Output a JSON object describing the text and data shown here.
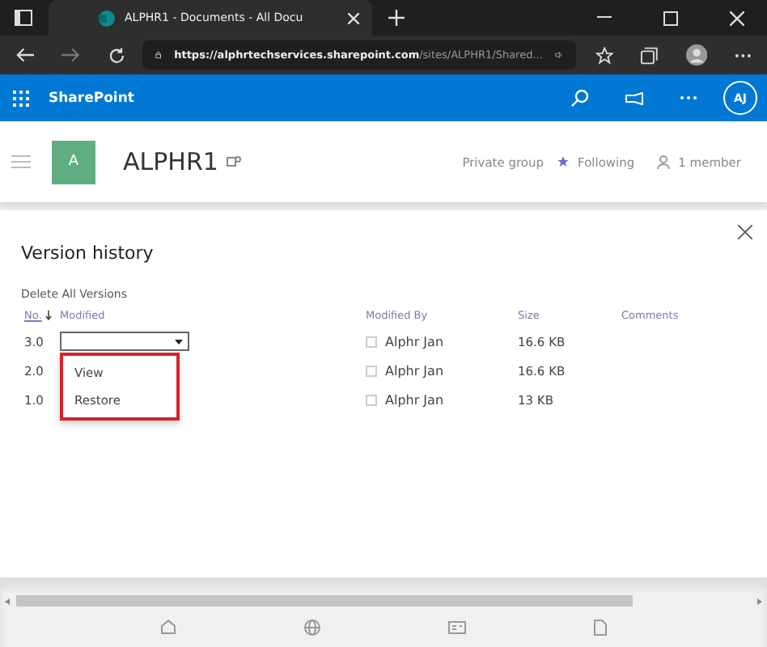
{
  "browser": {
    "tab_title": "ALPHR1 - Documents - All Docu",
    "url_host": "https://alphrtechservices.sharepoint.com",
    "url_path": "/sites/ALPHR1/Shared..."
  },
  "suite_bar": {
    "app_name": "SharePoint",
    "avatar": "AJ"
  },
  "site": {
    "logo_letter": "A",
    "name": "ALPHR1",
    "privacy": "Private group",
    "following": "Following",
    "members": "1 member"
  },
  "panel": {
    "title": "Version history",
    "delete_link": "Delete All Versions",
    "columns": [
      "No.",
      "Modified",
      "Modified By",
      "Size",
      "Comments"
    ],
    "rows": [
      {
        "no": "3.0",
        "menu_open": true,
        "modified_by": "Alphr Jan",
        "size": "16.6 KB"
      },
      {
        "no": "2.0",
        "menu_open": false,
        "modified_by": "Alphr Jan",
        "size": "16.6 KB"
      },
      {
        "no": "1.0",
        "menu_open": false,
        "modified_by": "Alphr Jan",
        "size": "13 KB"
      }
    ],
    "menu": [
      "View",
      "Restore"
    ]
  }
}
